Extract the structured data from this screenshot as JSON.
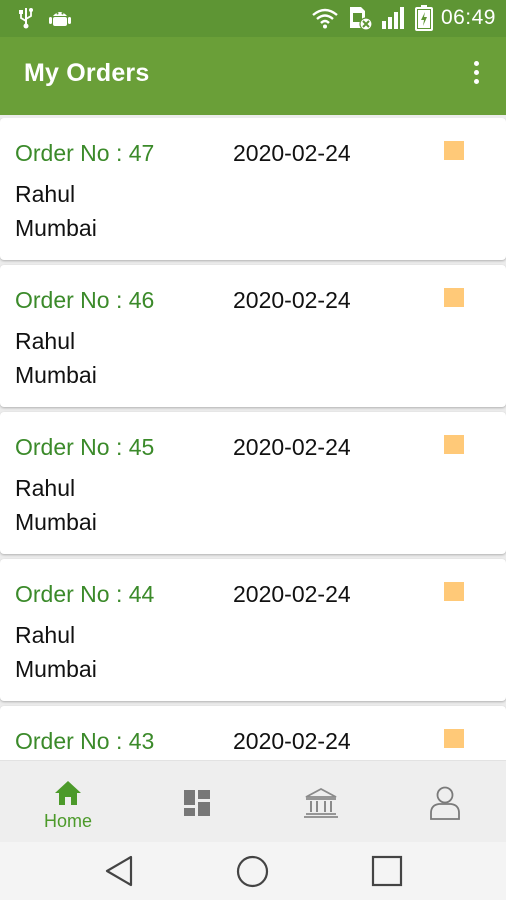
{
  "status_bar": {
    "time": "06:49",
    "icons": [
      "usb-icon",
      "android-debug-icon",
      "wifi-icon",
      "sim-blocked-icon",
      "signal-icon",
      "battery-charging-icon"
    ]
  },
  "app_bar": {
    "title": "My Orders",
    "menu_icon": "more-vert-icon"
  },
  "orders": [
    {
      "order_no": "Order No : 47",
      "date": "2020-02-24",
      "customer": "Rahul",
      "city": "Mumbai"
    },
    {
      "order_no": "Order No : 46",
      "date": "2020-02-24",
      "customer": "Rahul",
      "city": "Mumbai"
    },
    {
      "order_no": "Order No : 45",
      "date": "2020-02-24",
      "customer": "Rahul",
      "city": "Mumbai"
    },
    {
      "order_no": "Order No : 44",
      "date": "2020-02-24",
      "customer": "Rahul",
      "city": "Mumbai"
    },
    {
      "order_no": "Order No : 43",
      "date": "2020-02-24",
      "customer": "",
      "city": ""
    }
  ],
  "colors": {
    "status_bar": "#5e9534",
    "app_bar": "#6a9f38",
    "order_no_text": "#3b8a2a",
    "status_square": "#ffc978",
    "nav_active": "#4c9a2a"
  },
  "bottom_nav": {
    "items": [
      {
        "label": "Home",
        "icon": "home-icon",
        "active": true
      },
      {
        "label": "",
        "icon": "dashboard-icon",
        "active": false
      },
      {
        "label": "",
        "icon": "bank-icon",
        "active": false
      },
      {
        "label": "",
        "icon": "profile-icon",
        "active": false
      }
    ]
  },
  "system_nav": {
    "icons": [
      "back-icon",
      "home-circle-icon",
      "recents-icon"
    ]
  }
}
